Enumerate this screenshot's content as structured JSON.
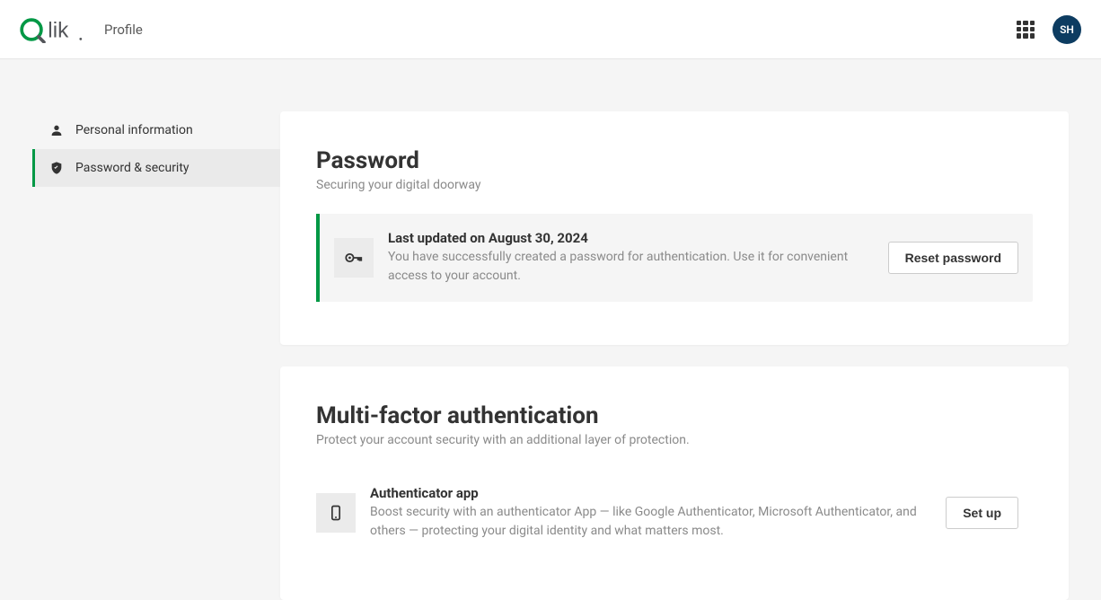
{
  "header": {
    "title": "Profile",
    "avatar_initials": "SH"
  },
  "sidebar": {
    "items": [
      {
        "label": "Personal information",
        "active": false
      },
      {
        "label": "Password & security",
        "active": true
      }
    ]
  },
  "sections": {
    "password": {
      "title": "Password",
      "subtitle": "Securing your digital doorway",
      "info_title": "Last updated on August 30, 2024",
      "info_desc": "You have successfully created a password for authentication. Use it for convenient access to your account.",
      "action_label": "Reset password"
    },
    "mfa": {
      "title": "Multi-factor authentication",
      "subtitle": "Protect your account security with an additional layer of protection.",
      "info_title": "Authenticator app",
      "info_desc": "Boost security with an authenticator App — like Google Authenticator, Microsoft Authenticator, and others — protecting your digital identity and what matters most.",
      "action_label": "Set up"
    }
  }
}
